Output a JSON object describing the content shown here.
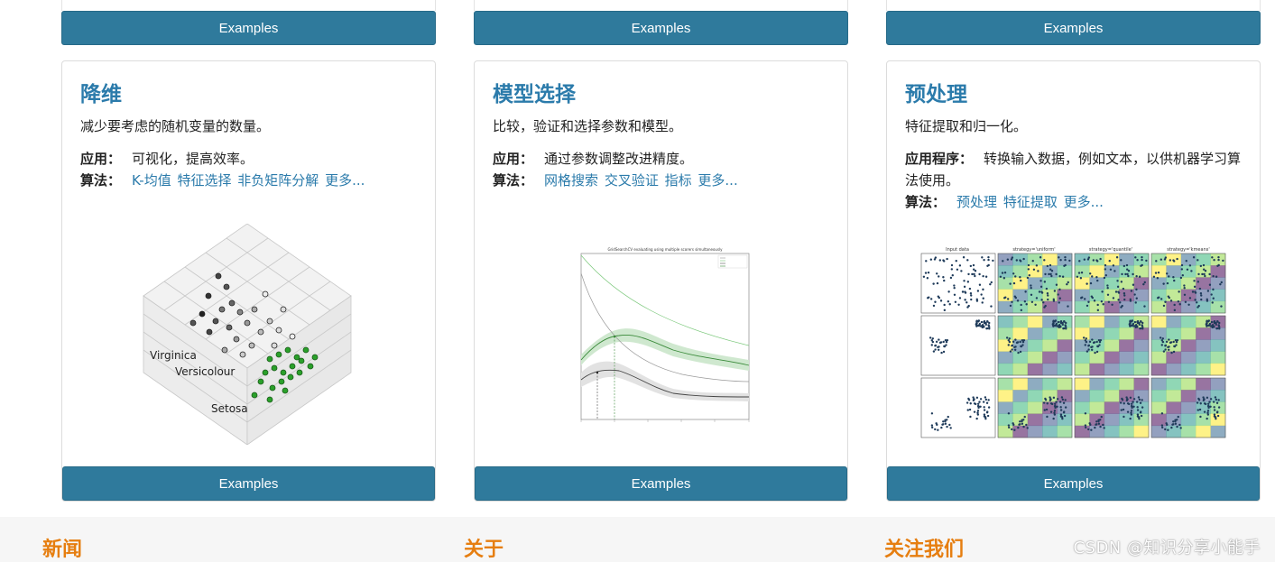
{
  "columns": [
    {
      "top_button": "Examples",
      "title": "降维",
      "description": "减少要考虑的随机变量的数量。",
      "app_label": "应用：",
      "app_text": "可视化，提高效率。",
      "algo_label": "算法：",
      "links": [
        "K-均值",
        "特征选择",
        "非负矩阵分解",
        "更多..."
      ],
      "figure_labels": [
        "Virginica",
        "Versicolour",
        "Setosa"
      ],
      "bottom_button": "Examples"
    },
    {
      "top_button": "Examples",
      "title": "模型选择",
      "description": "比较，验证和选择参数和模型。",
      "app_label": "应用：",
      "app_text": "通过参数调整改进精度。",
      "algo_label": "算法：",
      "links": [
        "网格搜索",
        "交叉验证",
        "指标",
        "更多..."
      ],
      "figure_title": "GridSearchCV evaluating using multiple scorers simultaneously",
      "bottom_button": "Examples"
    },
    {
      "top_button": "Examples",
      "title": "预处理",
      "description": "特征提取和归一化。",
      "app_label": "应用程序：",
      "app_text": "转换输入数据，例如文本，以供机器学习算法使用。",
      "algo_label": "算法：",
      "links": [
        "预处理",
        "特征提取",
        "更多..."
      ],
      "figure_titles": [
        "Input data",
        "strategy='uniform'",
        "strategy='quantile'",
        "strategy='kmeans'"
      ],
      "bottom_button": "Examples"
    }
  ],
  "footer": {
    "news": "新闻",
    "about": "关于",
    "follow": "关注我们",
    "watermark": "CSDN @知识分享小能手"
  },
  "colors": {
    "button": "#2f7a9c",
    "title": "#2b7bab",
    "footer_heading": "#e67e10"
  }
}
